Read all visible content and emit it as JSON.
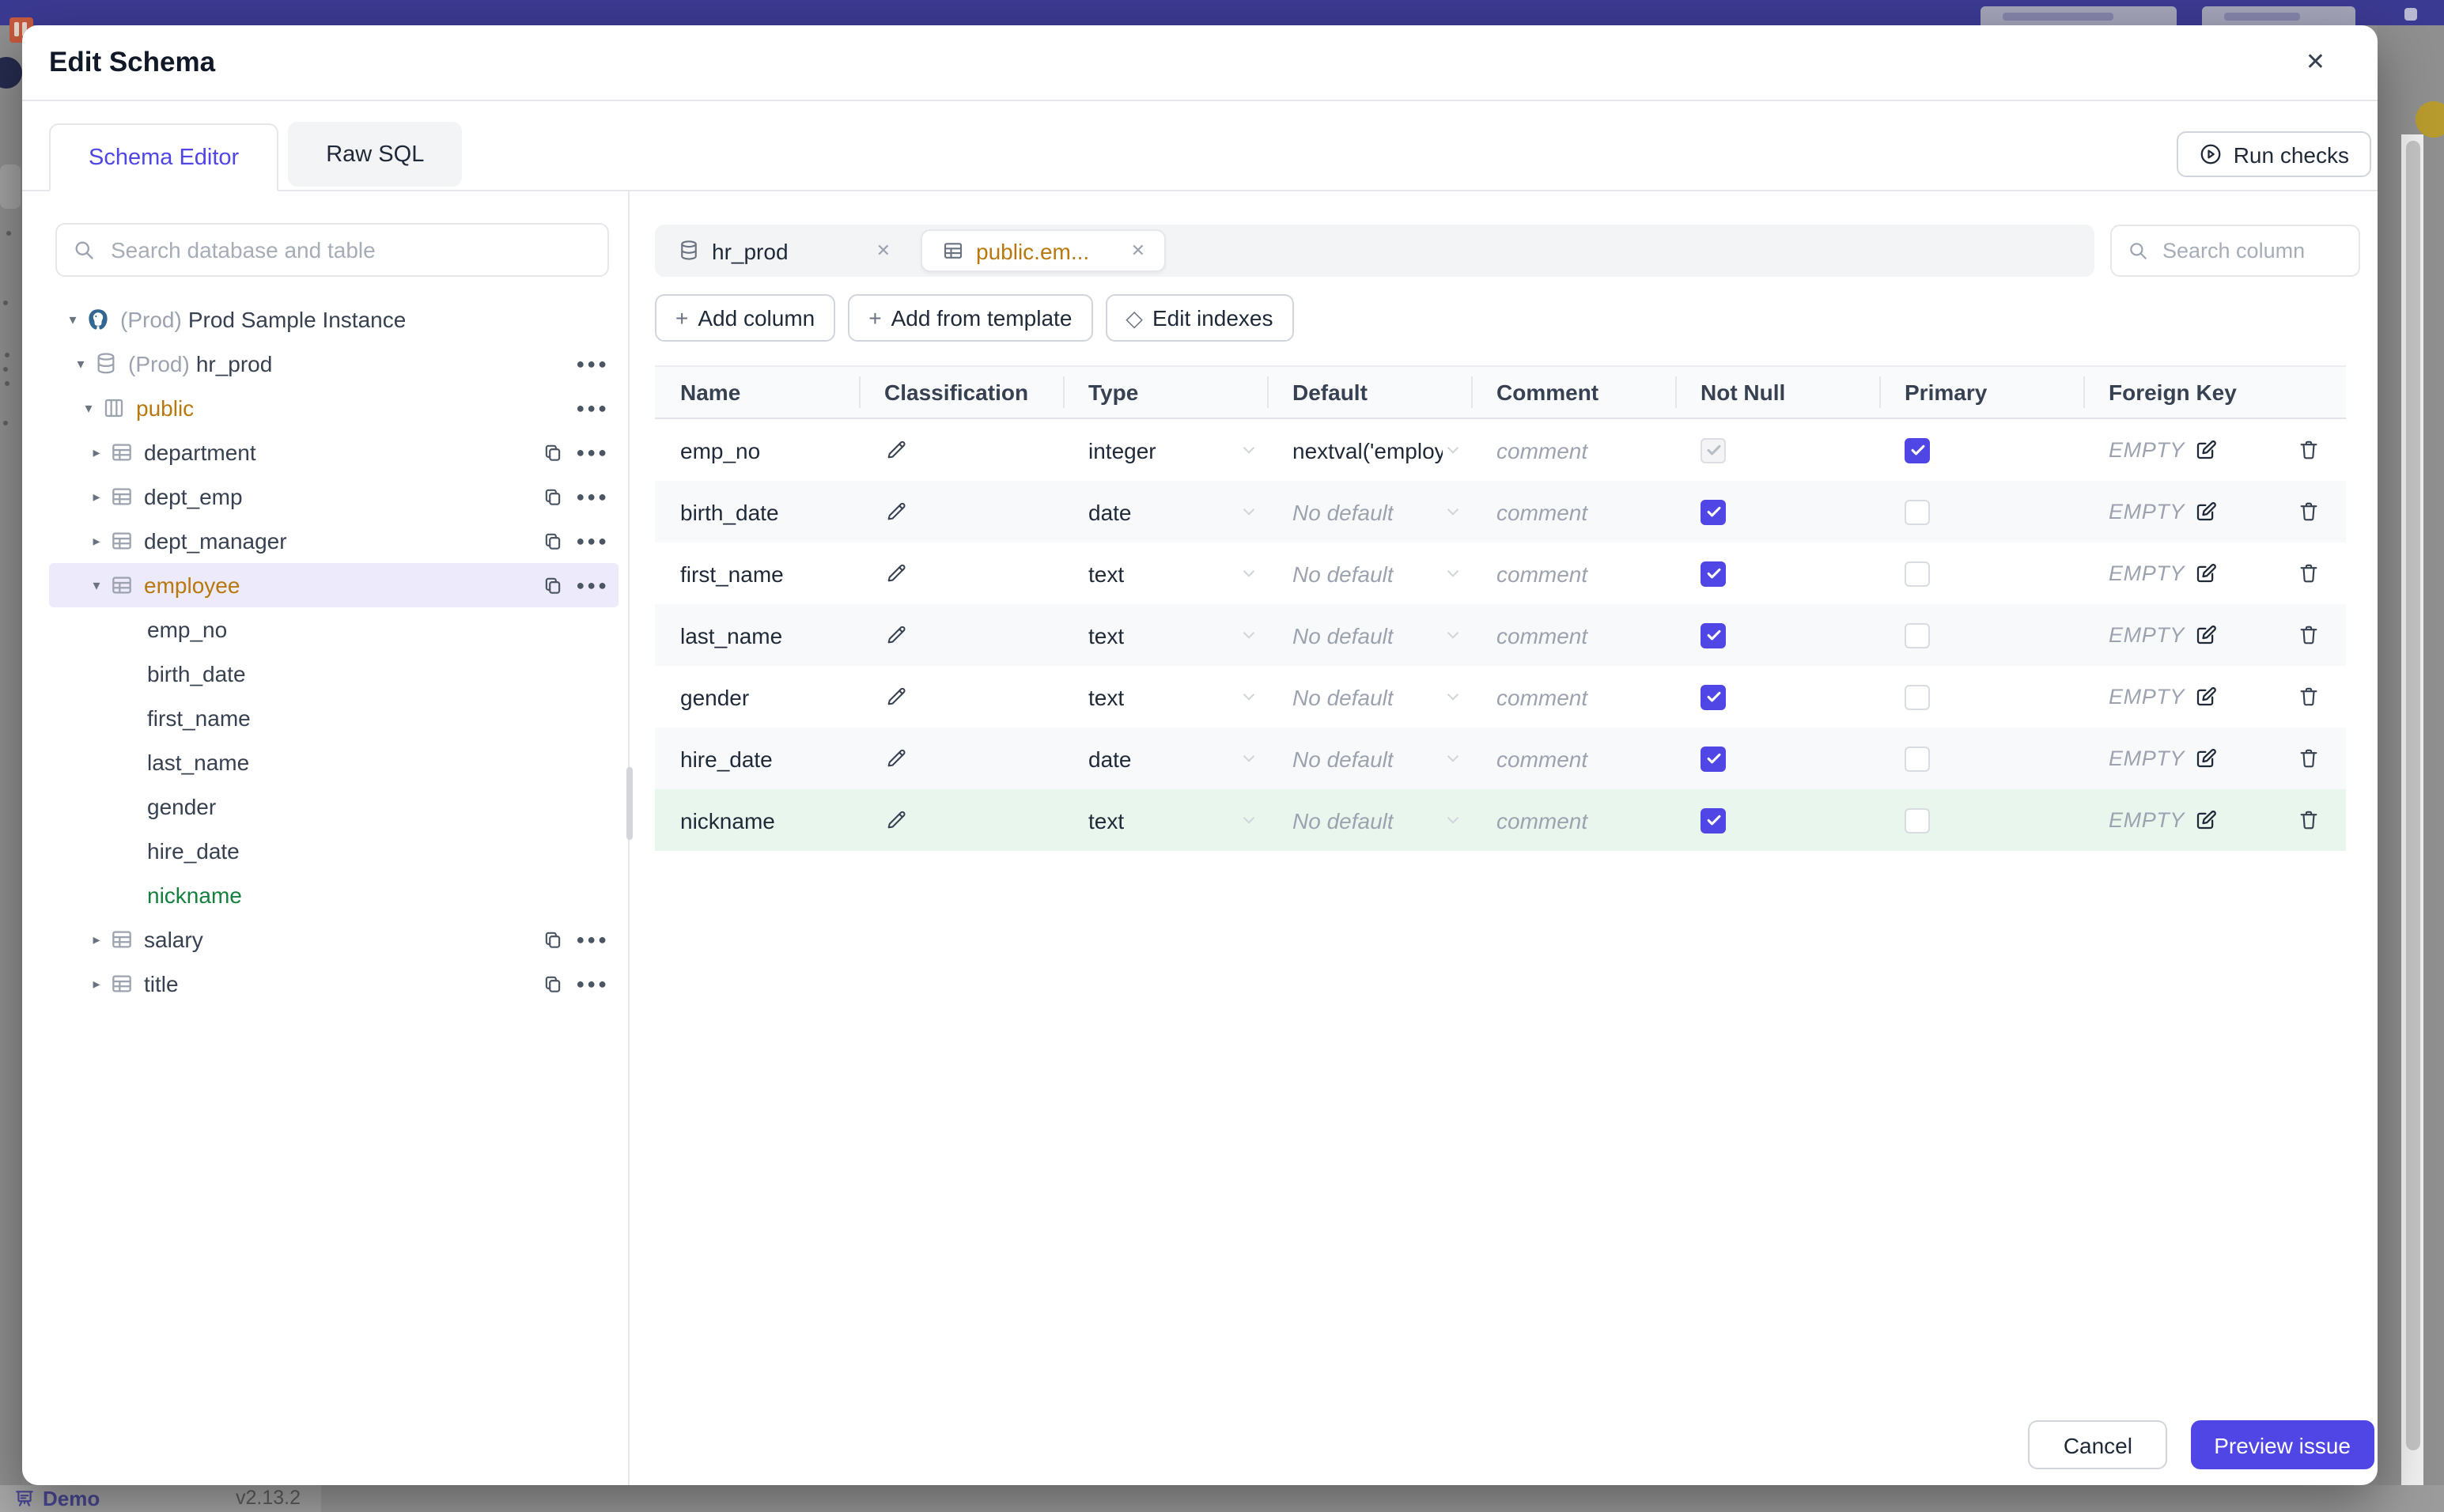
{
  "background": {
    "demo_label": "Demo",
    "version": "v2.13.2"
  },
  "modal": {
    "title": "Edit Schema",
    "close_glyph": "✕",
    "tabs": [
      {
        "label": "Schema Editor",
        "active": true
      },
      {
        "label": "Raw SQL",
        "active": false
      }
    ],
    "run_checks_label": "Run checks"
  },
  "sidebar": {
    "search_placeholder": "Search database and table",
    "tree": [
      {
        "type": "instance",
        "icon": "postgres-icon",
        "prefix": "(Prod)",
        "label": "Prod Sample Instance",
        "caret": "down",
        "level": 0
      },
      {
        "type": "database",
        "icon": "database-icon",
        "prefix": "(Prod)",
        "label": "hr_prod",
        "caret": "down",
        "level": 1,
        "actions": [
          "menu"
        ]
      },
      {
        "type": "schema",
        "icon": "schema-icon",
        "label": "public",
        "caret": "down",
        "level": 2,
        "highlight": "amber",
        "actions": [
          "menu"
        ]
      },
      {
        "type": "table",
        "icon": "table-icon",
        "label": "department",
        "caret": "right",
        "level": 3,
        "actions": [
          "copy",
          "menu"
        ]
      },
      {
        "type": "table",
        "icon": "table-icon",
        "label": "dept_emp",
        "caret": "right",
        "level": 3,
        "actions": [
          "copy",
          "menu"
        ]
      },
      {
        "type": "table",
        "icon": "table-icon",
        "label": "dept_manager",
        "caret": "right",
        "level": 3,
        "actions": [
          "copy",
          "menu"
        ]
      },
      {
        "type": "table",
        "icon": "table-icon",
        "label": "employee",
        "caret": "down",
        "level": 3,
        "highlight": "amber",
        "selected": true,
        "actions": [
          "copy",
          "menu"
        ]
      },
      {
        "type": "column",
        "label": "emp_no",
        "level": 4
      },
      {
        "type": "column",
        "label": "birth_date",
        "level": 4
      },
      {
        "type": "column",
        "label": "first_name",
        "level": 4
      },
      {
        "type": "column",
        "label": "last_name",
        "level": 4
      },
      {
        "type": "column",
        "label": "gender",
        "level": 4
      },
      {
        "type": "column",
        "label": "hire_date",
        "level": 4
      },
      {
        "type": "column",
        "label": "nickname",
        "level": 4,
        "highlight": "green"
      },
      {
        "type": "table",
        "icon": "table-icon",
        "label": "salary",
        "caret": "right",
        "level": 3,
        "actions": [
          "copy",
          "menu"
        ]
      },
      {
        "type": "table",
        "icon": "table-icon",
        "label": "title",
        "caret": "right",
        "level": 3,
        "actions": [
          "copy",
          "menu"
        ]
      }
    ]
  },
  "editor": {
    "tabs": [
      {
        "label": "hr_prod",
        "icon": "database-icon",
        "active": false,
        "close_glyph": "✕"
      },
      {
        "label": "public.em...",
        "icon": "table-icon",
        "active": true,
        "close_glyph": "✕"
      }
    ],
    "toolbar": [
      {
        "id": "add-column",
        "symbol": "+",
        "label": "Add column"
      },
      {
        "id": "add-from-template",
        "symbol": "+",
        "label": "Add from template"
      },
      {
        "id": "edit-indexes",
        "symbol": "◇",
        "label": "Edit indexes"
      }
    ],
    "search_placeholder": "Search column",
    "table": {
      "headers": [
        "Name",
        "Classification",
        "Type",
        "Default",
        "Comment",
        "Not Null",
        "Primary",
        "Foreign Key"
      ],
      "comment_placeholder": "comment",
      "foreign_key_empty": "EMPTY",
      "rows": [
        {
          "name": "emp_no",
          "type": "integer",
          "default": "nextval('employ",
          "default_muted": false,
          "not_null": "disabled-checked",
          "primary": true,
          "new": false
        },
        {
          "name": "birth_date",
          "type": "date",
          "default": "No default",
          "default_muted": true,
          "not_null": "checked",
          "primary": false,
          "new": false
        },
        {
          "name": "first_name",
          "type": "text",
          "default": "No default",
          "default_muted": true,
          "not_null": "checked",
          "primary": false,
          "new": false
        },
        {
          "name": "last_name",
          "type": "text",
          "default": "No default",
          "default_muted": true,
          "not_null": "checked",
          "primary": false,
          "new": false
        },
        {
          "name": "gender",
          "type": "text",
          "default": "No default",
          "default_muted": true,
          "not_null": "checked",
          "primary": false,
          "new": false
        },
        {
          "name": "hire_date",
          "type": "date",
          "default": "No default",
          "default_muted": true,
          "not_null": "checked",
          "primary": false,
          "new": false
        },
        {
          "name": "nickname",
          "type": "text",
          "default": "No default",
          "default_muted": true,
          "not_null": "checked",
          "primary": false,
          "new": true
        }
      ]
    }
  },
  "footer": {
    "cancel_label": "Cancel",
    "preview_label": "Preview issue"
  },
  "colors": {
    "accent_indigo": "#4f46e5",
    "amber_text": "#b8780d",
    "green_text": "#15803d",
    "new_row_bg": "#e9f6ee",
    "topbar_purple": "#3b3a92"
  }
}
